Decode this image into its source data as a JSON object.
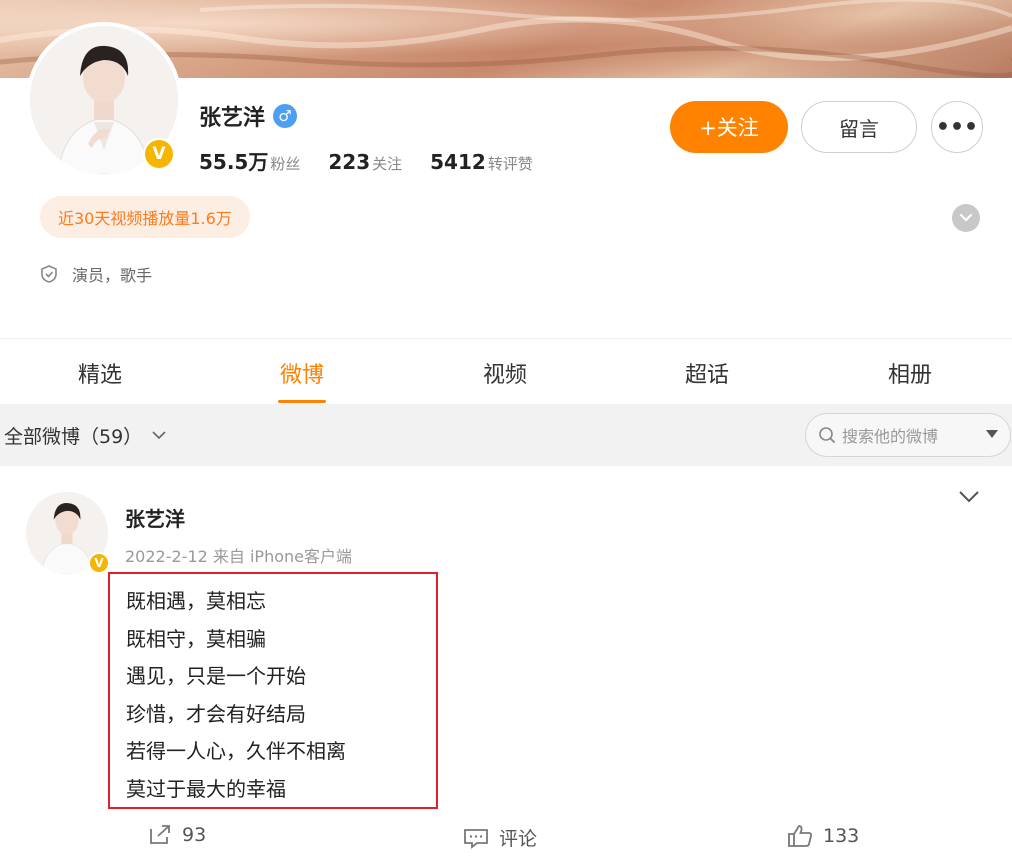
{
  "profile": {
    "name": "张艺洋",
    "gender_icon": "male-icon",
    "stats": [
      {
        "value": "55.5万",
        "label": "粉丝"
      },
      {
        "value": "223",
        "label": "关注"
      },
      {
        "value": "5412",
        "label": "转评赞"
      }
    ],
    "follow_label": "+关注",
    "message_label": "留言",
    "more_label": "•••",
    "video_plays": "近30天视频播放量1.6万",
    "occupation": "演员，歌手"
  },
  "tabs": [
    "精选",
    "微博",
    "视频",
    "超话",
    "相册"
  ],
  "active_tab": "微博",
  "filter": {
    "label": "全部微博（59）",
    "search_placeholder": "搜索他的微博"
  },
  "post": {
    "author": "张艺洋",
    "meta": "2022-2-12 来自 iPhone客户端",
    "lines": [
      "既相遇，莫相忘",
      "既相守，莫相骗",
      "遇见，只是一个开始",
      "珍惜，才会有好结局",
      "若得一人心，久伴不相离",
      "莫过于最大的幸福"
    ],
    "repost_count": "93",
    "comment_label": "评论",
    "like_count": "133"
  },
  "colors": {
    "accent": "#ff8200",
    "verified": "#f6b500",
    "highlight_border": "#e0202a"
  }
}
